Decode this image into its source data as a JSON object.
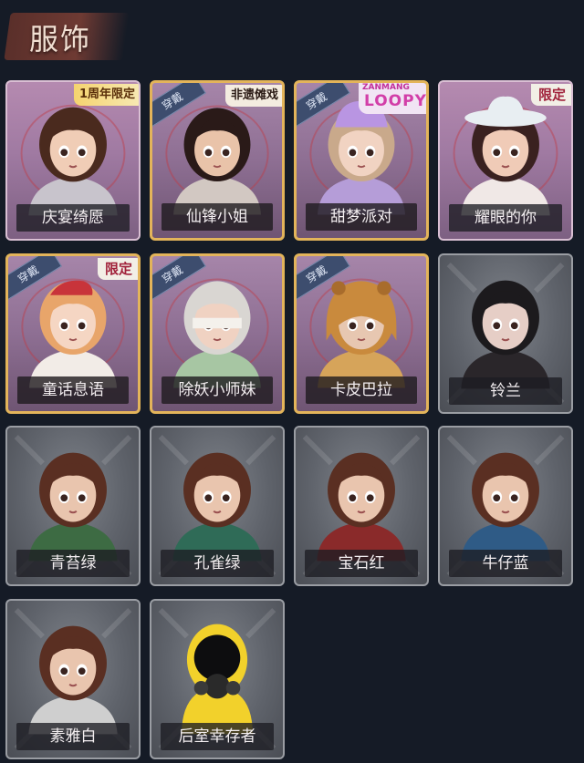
{
  "header": {
    "title": "服饰"
  },
  "common": {
    "wear_label": "穿戴"
  },
  "cards": [
    {
      "name": "庆宴绮愿",
      "style": "purple",
      "tag": "anniv",
      "tag_text": "1周年限定",
      "worn": false,
      "hair": "#4a2a1e",
      "skin": "#f0cdb6",
      "outfit": "#c8c4cc"
    },
    {
      "name": "仙锋小姐",
      "style": "gold",
      "tag": "heritage",
      "tag_text": "非遗傩戏",
      "worn": true,
      "hair": "#2a1a18",
      "skin": "#e9c3a9",
      "outfit": "#d2c8c2"
    },
    {
      "name": "甜梦派对",
      "style": "gold",
      "tag": "loopy",
      "tag_text": "LOOPY",
      "tag_sub": "ZANMANG",
      "worn": true,
      "hair": "#c9a98b",
      "skin": "#f1d3c2",
      "outfit": "#b59dd8"
    },
    {
      "name": "耀眼的你",
      "style": "purple",
      "tag": "limited",
      "tag_text": "限定",
      "worn": false,
      "hair": "#3a2120",
      "skin": "#f0cbb7",
      "outfit": "#f0e8e6"
    },
    {
      "name": "童话息语",
      "style": "gold",
      "tag": "limited",
      "tag_text": "限定",
      "worn": true,
      "hair": "#e8a56a",
      "skin": "#f5d6c3",
      "outfit": "#f2ece7"
    },
    {
      "name": "除妖小师妹",
      "style": "gold",
      "tag": "",
      "tag_text": "",
      "worn": true,
      "hair": "#d9d6d2",
      "skin": "#f0d2c2",
      "outfit": "#a7c6a3"
    },
    {
      "name": "卡皮巴拉",
      "style": "gold",
      "tag": "",
      "tag_text": "",
      "worn": true,
      "hair": "#c98a3d",
      "skin": "#e7c7b1",
      "outfit": "#d6a45a"
    },
    {
      "name": "铃兰",
      "style": "gray",
      "tag": "",
      "tag_text": "",
      "worn": false,
      "hair": "#1c1a1d",
      "skin": "#e6cec6",
      "outfit": "#2a262a"
    },
    {
      "name": "青苔绿",
      "style": "gray",
      "tag": "",
      "tag_text": "",
      "worn": false,
      "hair": "#5a2f22",
      "skin": "#e9c5ae",
      "outfit": "#3d6b43"
    },
    {
      "name": "孔雀绿",
      "style": "gray",
      "tag": "",
      "tag_text": "",
      "worn": false,
      "hair": "#5a2f22",
      "skin": "#e9c5ae",
      "outfit": "#2f6b57"
    },
    {
      "name": "宝石红",
      "style": "gray",
      "tag": "",
      "tag_text": "",
      "worn": false,
      "hair": "#5a2f22",
      "skin": "#e9c5ae",
      "outfit": "#8a2a2a"
    },
    {
      "name": "牛仔蓝",
      "style": "gray",
      "tag": "",
      "tag_text": "",
      "worn": false,
      "hair": "#5a2f22",
      "skin": "#e9c5ae",
      "outfit": "#2f5b86"
    },
    {
      "name": "素雅白",
      "style": "gray",
      "tag": "",
      "tag_text": "",
      "worn": false,
      "hair": "#5a2f22",
      "skin": "#e9c5ae",
      "outfit": "#cfcfcf"
    },
    {
      "name": "后室幸存者",
      "style": "gray",
      "tag": "",
      "tag_text": "",
      "worn": false,
      "hair": "#f2d12b",
      "skin": "#1a1a1a",
      "outfit": "#f2d12b"
    }
  ]
}
